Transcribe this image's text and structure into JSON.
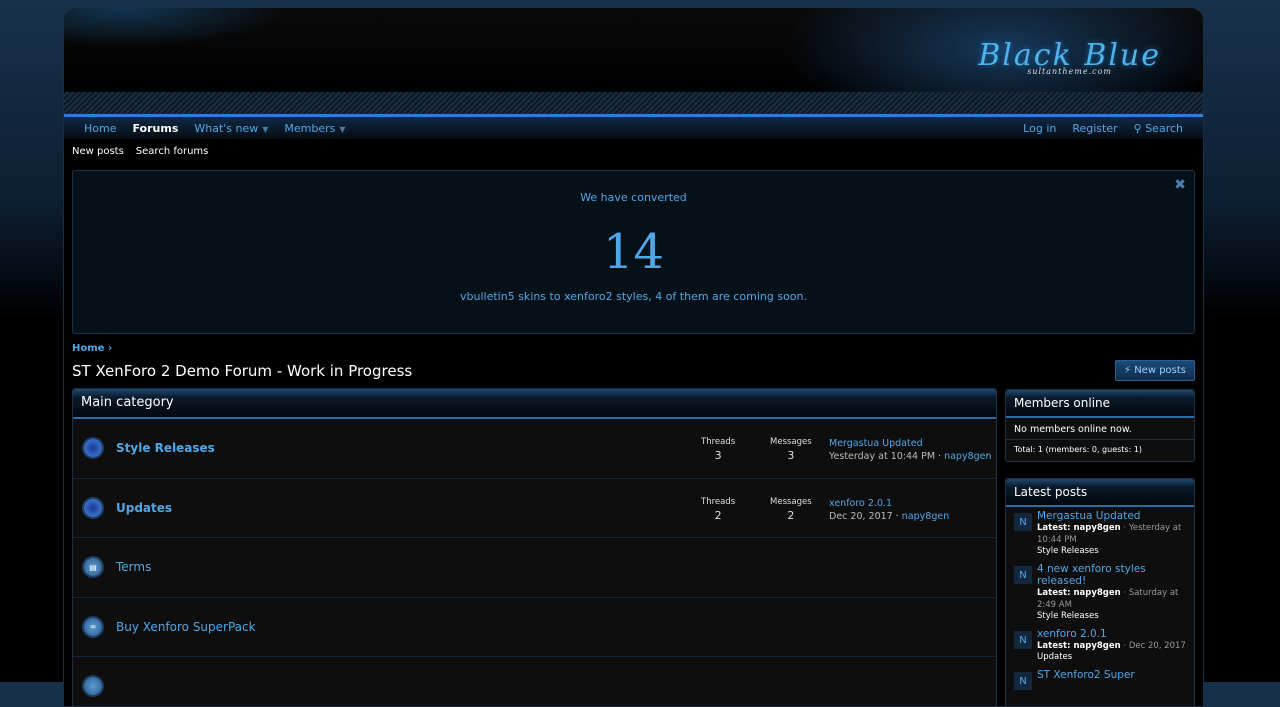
{
  "logo": {
    "title": "Black Blue",
    "subtitle": "sultantheme.com"
  },
  "nav": {
    "items": [
      {
        "label": "Home"
      },
      {
        "label": "Forums"
      },
      {
        "label": "What's new"
      },
      {
        "label": "Members"
      }
    ],
    "login": "Log in",
    "register": "Register",
    "search": "Search"
  },
  "subnav": {
    "new_posts": "New posts",
    "search_forums": "Search forums"
  },
  "notice": {
    "line1": "We have converted",
    "number": "14",
    "line3": "vbulletin5 skins to xenforo2 styles, 4 of them are coming soon.",
    "close": "✖"
  },
  "breadcrumb": {
    "home": "Home"
  },
  "page_title": "ST XenForo 2 Demo Forum - Work in Progress",
  "new_posts_button": "New posts",
  "category": {
    "title": "Main category",
    "forums": [
      {
        "name": "Style Releases",
        "threads_label": "Threads",
        "threads": "3",
        "messages_label": "Messages",
        "messages": "3",
        "last_title": "Mergastua Updated",
        "last_date": "Yesterday at 10:44 PM",
        "last_user": "napy8gen"
      },
      {
        "name": "Updates",
        "threads_label": "Threads",
        "threads": "2",
        "messages_label": "Messages",
        "messages": "2",
        "last_title": "xenforo 2.0.1",
        "last_date": "Dec 20, 2017",
        "last_user": "napy8gen"
      },
      {
        "name": "Terms"
      },
      {
        "name": "Buy Xenforo SuperPack"
      }
    ]
  },
  "members_online": {
    "title": "Members online",
    "none": "No members online now.",
    "total": "Total: 1 (members: 0, guests: 1)"
  },
  "latest_posts": {
    "title": "Latest posts",
    "items": [
      {
        "avatar": "N",
        "title": "Mergastua Updated",
        "latest": "Latest: napy8gen",
        "date": "Yesterday at 10:44 PM",
        "forum": "Style Releases"
      },
      {
        "avatar": "N",
        "title": "4 new xenforo styles released!",
        "latest": "Latest: napy8gen",
        "date": "Saturday at 2:49 AM",
        "forum": "Style Releases"
      },
      {
        "avatar": "N",
        "title": "xenforo 2.0.1",
        "latest": "Latest: napy8gen",
        "date": "Dec 20, 2017",
        "forum": "Updates"
      },
      {
        "avatar": "N",
        "title": "ST Xenforo2 Super"
      }
    ]
  }
}
